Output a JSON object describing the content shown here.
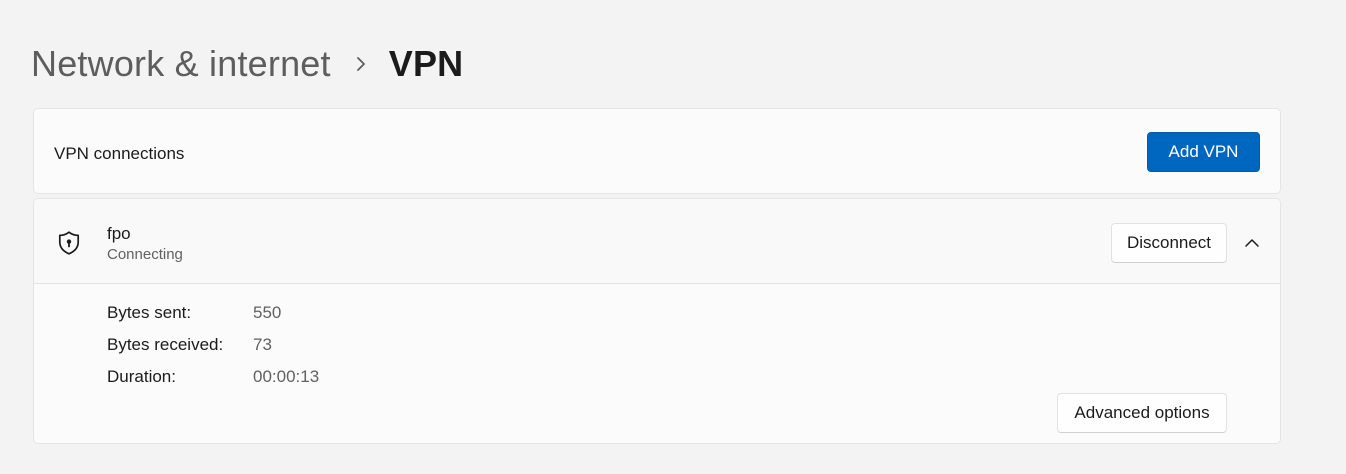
{
  "breadcrumb": {
    "parent": "Network & internet",
    "separator_icon": "chevron-right-icon",
    "current": "VPN"
  },
  "connections_card": {
    "label": "VPN connections",
    "add_button": "Add VPN"
  },
  "vpn": {
    "icon": "shield-lock-icon",
    "name": "fpo",
    "status": "Connecting",
    "disconnect_button": "Disconnect",
    "collapse_icon": "chevron-up-icon",
    "details": [
      {
        "label": "Bytes sent:",
        "value": "550"
      },
      {
        "label": "Bytes received:",
        "value": "73"
      },
      {
        "label": "Duration:",
        "value": "00:00:13"
      }
    ],
    "advanced_button": "Advanced options"
  },
  "colors": {
    "accent": "#0067c0",
    "background": "#f3f3f3",
    "card": "#fbfbfb",
    "secondary_text": "#616161"
  }
}
